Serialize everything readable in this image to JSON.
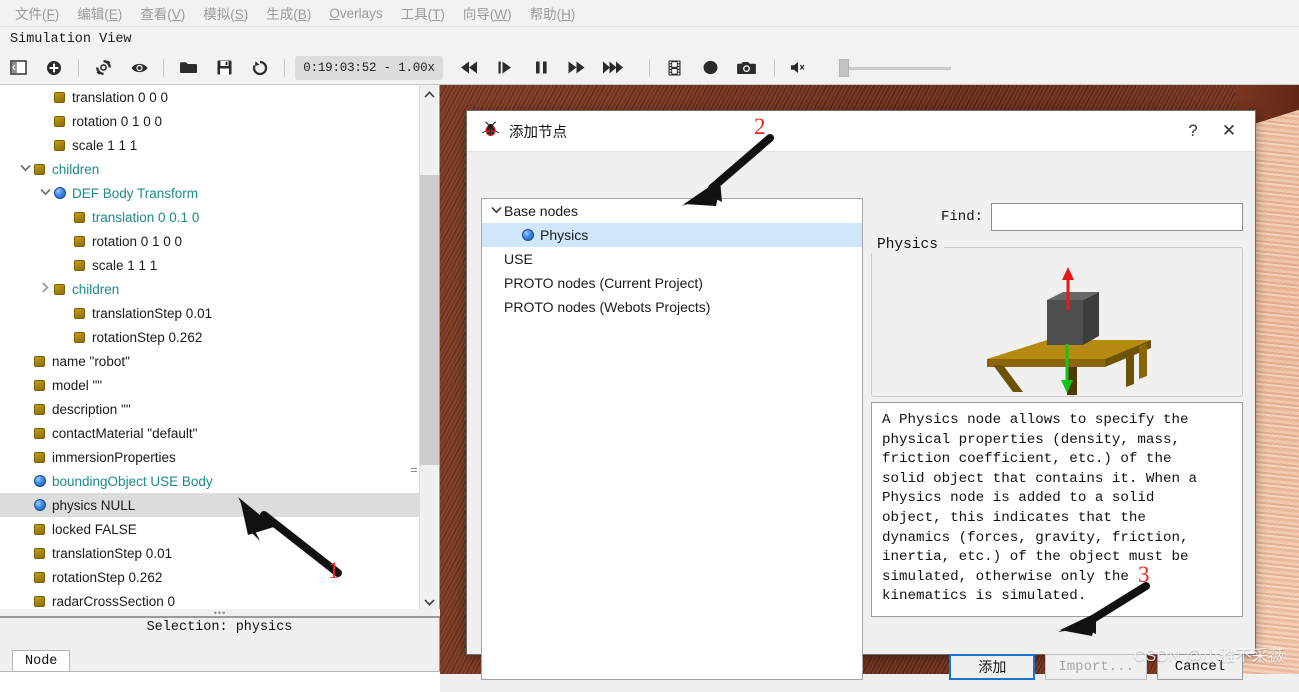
{
  "menubar": {
    "items": [
      {
        "label": "文件(F)",
        "accel": "F"
      },
      {
        "label": "编辑(E)",
        "accel": "E"
      },
      {
        "label": "查看(V)",
        "accel": "V"
      },
      {
        "label": "模拟(S)",
        "accel": "S"
      },
      {
        "label": "生成(B)",
        "accel": "B"
      },
      {
        "label": "Overlays",
        "accel": "O"
      },
      {
        "label": "工具(T)",
        "accel": "T"
      },
      {
        "label": "向导(W)",
        "accel": "W"
      },
      {
        "label": "帮助(H)",
        "accel": "H"
      }
    ]
  },
  "simulation_view": {
    "title": "Simulation View"
  },
  "toolbar": {
    "time_display": "0:19:03:52 - 1.00x",
    "buttons": [
      {
        "name": "toggle-panel",
        "icon": "panel-icon"
      },
      {
        "name": "add-node",
        "icon": "plus-circle-icon"
      },
      {
        "name": "reload-world",
        "icon": "revert-icon"
      },
      {
        "name": "view-mode",
        "icon": "eye-icon"
      },
      {
        "name": "open-world",
        "icon": "folder-icon"
      },
      {
        "name": "save-world",
        "icon": "save-icon"
      },
      {
        "name": "reset-simulation",
        "icon": "reset-icon"
      },
      {
        "name": "rewind",
        "icon": "rewind-icon"
      },
      {
        "name": "step",
        "icon": "step-icon"
      },
      {
        "name": "pause",
        "icon": "pause-icon"
      },
      {
        "name": "run",
        "icon": "fast-forward-icon"
      },
      {
        "name": "fast-run",
        "icon": "fastest-icon"
      },
      {
        "name": "make-movie",
        "icon": "film-icon"
      },
      {
        "name": "record",
        "icon": "record-icon"
      },
      {
        "name": "screenshot",
        "icon": "camera-icon"
      },
      {
        "name": "mute",
        "icon": "speaker-mute-icon"
      }
    ],
    "volume_value": 0
  },
  "scene_tree": {
    "rows": [
      {
        "indent": 1,
        "arrow": "",
        "icon": "field",
        "label": "translation 0 0 0",
        "color": "black",
        "selected": false
      },
      {
        "indent": 1,
        "arrow": "",
        "icon": "field",
        "label": "rotation 0 1 0 0",
        "color": "black",
        "selected": false
      },
      {
        "indent": 1,
        "arrow": "",
        "icon": "field",
        "label": "scale 1 1 1",
        "color": "black",
        "selected": false
      },
      {
        "indent": 0,
        "arrow": "down",
        "icon": "field",
        "label": "children",
        "color": "teal",
        "selected": false
      },
      {
        "indent": 1,
        "arrow": "down",
        "icon": "node",
        "label": "DEF Body Transform",
        "color": "teal",
        "selected": false
      },
      {
        "indent": 2,
        "arrow": "",
        "icon": "field",
        "label": "translation 0 0.1 0",
        "color": "teal",
        "selected": false
      },
      {
        "indent": 2,
        "arrow": "",
        "icon": "field",
        "label": "rotation 0 1 0 0",
        "color": "black",
        "selected": false
      },
      {
        "indent": 2,
        "arrow": "",
        "icon": "field",
        "label": "scale 1 1 1",
        "color": "black",
        "selected": false
      },
      {
        "indent": 1,
        "arrow": "right",
        "icon": "field",
        "label": "children",
        "color": "teal",
        "selected": false
      },
      {
        "indent": 2,
        "arrow": "",
        "icon": "field",
        "label": "translationStep 0.01",
        "color": "black",
        "selected": false
      },
      {
        "indent": 2,
        "arrow": "",
        "icon": "field",
        "label": "rotationStep 0.262",
        "color": "black",
        "selected": false
      },
      {
        "indent": 0,
        "arrow": "",
        "icon": "field",
        "label": "name \"robot\"",
        "color": "black",
        "selected": false
      },
      {
        "indent": 0,
        "arrow": "",
        "icon": "field",
        "label": "model \"\"",
        "color": "black",
        "selected": false
      },
      {
        "indent": 0,
        "arrow": "",
        "icon": "field",
        "label": "description \"\"",
        "color": "black",
        "selected": false
      },
      {
        "indent": 0,
        "arrow": "",
        "icon": "field",
        "label": "contactMaterial \"default\"",
        "color": "black",
        "selected": false
      },
      {
        "indent": 0,
        "arrow": "",
        "icon": "field",
        "label": "immersionProperties",
        "color": "black",
        "selected": false
      },
      {
        "indent": 0,
        "arrow": "",
        "icon": "node",
        "label": "boundingObject USE Body",
        "color": "teal",
        "selected": false
      },
      {
        "indent": 0,
        "arrow": "",
        "icon": "node",
        "label": "physics NULL",
        "color": "black",
        "selected": true
      },
      {
        "indent": 0,
        "arrow": "",
        "icon": "field",
        "label": "locked FALSE",
        "color": "black",
        "selected": false
      },
      {
        "indent": 0,
        "arrow": "",
        "icon": "field",
        "label": "translationStep 0.01",
        "color": "black",
        "selected": false
      },
      {
        "indent": 0,
        "arrow": "",
        "icon": "field",
        "label": "rotationStep 0.262",
        "color": "black",
        "selected": false
      },
      {
        "indent": 0,
        "arrow": "",
        "icon": "field",
        "label": "radarCrossSection 0",
        "color": "black",
        "selected": false
      }
    ]
  },
  "selection_pane": {
    "selection_text": "Selection: physics",
    "tabs": [
      {
        "label": "Node",
        "active": true
      }
    ]
  },
  "dialog": {
    "title": "添加节点",
    "icon": "webots-ladybug-icon",
    "help_label": "?",
    "close_label": "✕",
    "node_list": [
      {
        "label": "Base nodes",
        "arrow": "down",
        "icon": "none",
        "indent": 0,
        "selected": false
      },
      {
        "label": "Physics",
        "arrow": "",
        "icon": "node",
        "indent": 1,
        "selected": true
      },
      {
        "label": "USE",
        "arrow": "",
        "icon": "none",
        "indent": 0,
        "selected": false
      },
      {
        "label": "PROTO nodes (Current Project)",
        "arrow": "",
        "icon": "none",
        "indent": 0,
        "selected": false
      },
      {
        "label": "PROTO nodes (Webots Projects)",
        "arrow": "",
        "icon": "none",
        "indent": 0,
        "selected": false
      }
    ],
    "find": {
      "label": "Find:",
      "value": "",
      "placeholder": ""
    },
    "preview_group_label": "Physics",
    "preview_icon": "physics-table-box-arrows-illustration",
    "description": "A Physics node allows to specify the\nphysical properties (density, mass,\nfriction coefficient, etc.) of the\nsolid object that contains it. When a\nPhysics node is added to a solid\nobject, this indicates that the\ndynamics (forces, gravity, friction,\ninertia, etc.) of the object must be\nsimulated, otherwise only the\nkinematics is simulated.",
    "buttons": [
      {
        "label": "添加",
        "state": "default-primary"
      },
      {
        "label": "Import...",
        "state": "disabled"
      },
      {
        "label": "Cancel",
        "state": "enabled"
      }
    ]
  },
  "annotations": [
    {
      "number": "1",
      "color": "#e8281e"
    },
    {
      "number": "2",
      "color": "#e8281e"
    },
    {
      "number": "3",
      "color": "#e8281e"
    }
  ],
  "watermark": {
    "text": "CSDN @小雅不采薇"
  },
  "colors": {
    "selection_blue": "#cfe6fb",
    "tree_selection_gray": "#dcdcdc",
    "teal_text": "#1b8a8a",
    "accent_button_border": "#1673d0",
    "annotation_red": "#e8281e"
  }
}
